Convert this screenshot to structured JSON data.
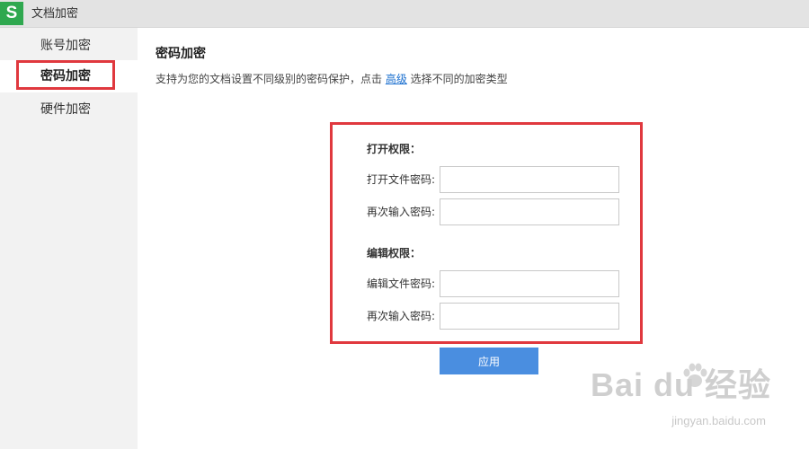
{
  "window": {
    "logo": "S",
    "title": "文档加密"
  },
  "sidebar": {
    "items": [
      {
        "label": "账号加密",
        "active": false
      },
      {
        "label": "密码加密",
        "active": true
      },
      {
        "label": "硬件加密",
        "active": false
      }
    ]
  },
  "main": {
    "title": "密码加密",
    "description_before": "支持为您的文档设置不同级别的密码保护，点击 ",
    "advanced_link": "高级",
    "description_after": " 选择不同的加密类型",
    "open_section": {
      "heading": "打开权限：",
      "password_label": "打开文件密码:",
      "confirm_label": "再次输入密码:",
      "password_value": "",
      "confirm_value": ""
    },
    "edit_section": {
      "heading": "编辑权限：",
      "password_label": "编辑文件密码:",
      "confirm_label": "再次输入密码:",
      "password_value": "",
      "confirm_value": ""
    },
    "apply_label": "应用"
  },
  "watermark": {
    "brand": "Bai du 经验",
    "url": "jingyan.baidu.com"
  },
  "colors": {
    "highlight": "#e0383e",
    "accent": "#4a8ee0",
    "logo": "#2fa84f",
    "link": "#1a6fcf"
  }
}
